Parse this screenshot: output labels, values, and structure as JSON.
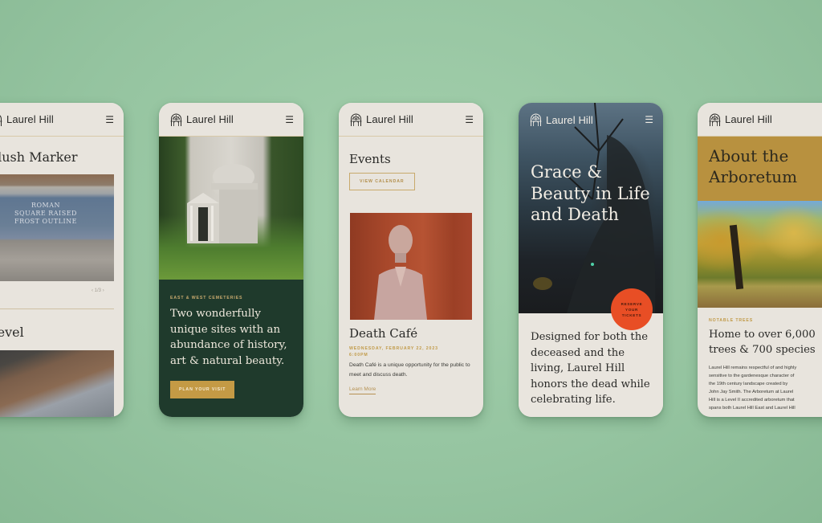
{
  "brand": {
    "name": "Laurel Hill",
    "logo_icon": "arch-gate-icon",
    "menu_icon": "hamburger-menu-icon",
    "colors": {
      "background": "#9cc9a6",
      "card": "#e8e4dd",
      "forest_green": "#1f3a2c",
      "gold": "#c49a45",
      "red_orange": "#e84e25",
      "ink": "#2a2a28"
    }
  },
  "screens": [
    {
      "id": "flush-marker",
      "sections": [
        {
          "title": "Flush Marker",
          "image_alt": "Granite flush grave marker",
          "stone_lines": [
            "ROMAN",
            "SQUARE RAISED",
            "FROST OUTLINE"
          ],
          "pager": "1/3"
        },
        {
          "title": "Level"
        }
      ]
    },
    {
      "id": "home",
      "hero_image_alt": "Domed marble mausoleum among trees",
      "eyebrow": "East & West Cemeteries",
      "headline": "Two wonderfully unique sites with an abundance of history, art & natural beauty.",
      "cta": "Plan Your Visit"
    },
    {
      "id": "events",
      "title": "Events",
      "calendar_button": "View Calendar",
      "event": {
        "image_alt": "Marble bust sculpture against red wood",
        "title": "Death Café",
        "date": "Wednesday, February 22, 2023",
        "time": "6:00PM",
        "description": "Death Café is a unique opportunity for the public to meet and discuss death.",
        "link": "Learn More"
      }
    },
    {
      "id": "grace",
      "hero_title": "Grace & Beauty in Life and Death",
      "badge": [
        "Reserve",
        "Your",
        "Tickets"
      ],
      "statement": "Designed for both the deceased and the living, Laurel Hill honors the dead while celebrating life."
    },
    {
      "id": "arboretum",
      "banner_title": "About the Arboretum",
      "image_alt": "Autumn trees in a sunny meadow",
      "eyebrow": "Notable Trees",
      "subtitle_lines": [
        "Home to over 6,000",
        "trees & 700 species"
      ],
      "body_lines": [
        "Laurel Hill remains respectful of and highly",
        "sensitive to the gardenesque character of",
        "the 19th century landscape created by",
        "John Jay Smith. The Arboretum at Laurel",
        "Hill is a Level II accredited arboretum that",
        "spans both Laurel Hill East and Laurel Hill"
      ]
    }
  ]
}
